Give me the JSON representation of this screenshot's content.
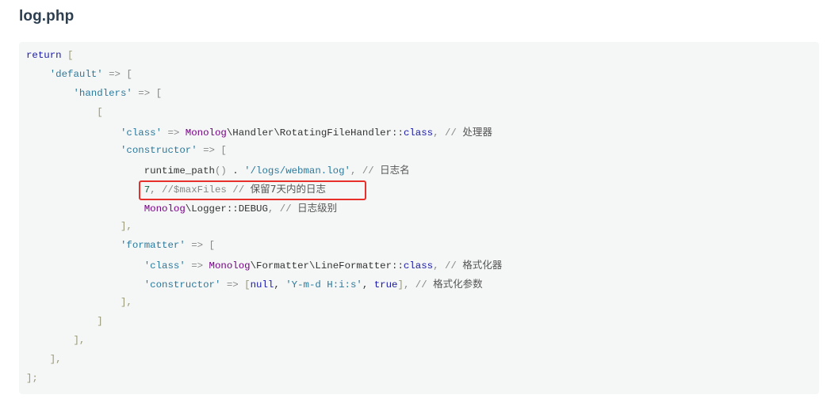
{
  "file_title": "log.php",
  "colors": {
    "highlight_border": "#e8302a",
    "code_background": "#f5f6f6",
    "string": "#2b7a9c",
    "class": "#770088",
    "keyword": "#1a1aa6"
  },
  "code": {
    "l1_return": "return",
    "l1_bracket": " [",
    "l2_key": "'default'",
    "l2_arrow": " => [",
    "l3_key": "'handlers'",
    "l3_arrow": " => [",
    "l4_bracket": "[",
    "l5_key": "'class'",
    "l5_arrow": " => ",
    "l5_ns": "Monolog",
    "l5_path": "\\Handler\\RotatingFileHandler::",
    "l5_kw": "class",
    "l5_comment": ", // ",
    "l5_cjk": "处理器",
    "l6_key": "'constructor'",
    "l6_arrow": " => [",
    "l7_fn": "runtime_path",
    "l7_paren": "()",
    "l7_dot": " . ",
    "l7_str": "'/logs/webman.log'",
    "l7_comment": ", // ",
    "l7_cjk": "日志名",
    "l8_num": "7",
    "l8_comment": ", //$maxFiles // ",
    "l8_cjk": "保留7天内的日志",
    "l9_ns": "Monolog",
    "l9_path": "\\Logger::DEBUG",
    "l9_comment": ", // ",
    "l9_cjk": "日志级别",
    "l10_close": "],",
    "l11_key": "'formatter'",
    "l11_arrow": " => [",
    "l12_key": "'class'",
    "l12_arrow": " => ",
    "l12_ns": "Monolog",
    "l12_path": "\\Formatter\\LineFormatter::",
    "l12_kw": "class",
    "l12_comment": ", // ",
    "l12_cjk": "格式化器",
    "l13_key": "'constructor'",
    "l13_arrow": " => ",
    "l13_open": "[",
    "l13_null": "null",
    "l13_sep1": ", ",
    "l13_str": "'Y-m-d H:i:s'",
    "l13_sep2": ", ",
    "l13_true": "true",
    "l13_close": "]",
    "l13_comment": ", // ",
    "l13_cjk": "格式化参数",
    "l14_close": "],",
    "l15_close": "]",
    "l16_close": "],",
    "l17_close": "],",
    "l18_close": "];"
  }
}
